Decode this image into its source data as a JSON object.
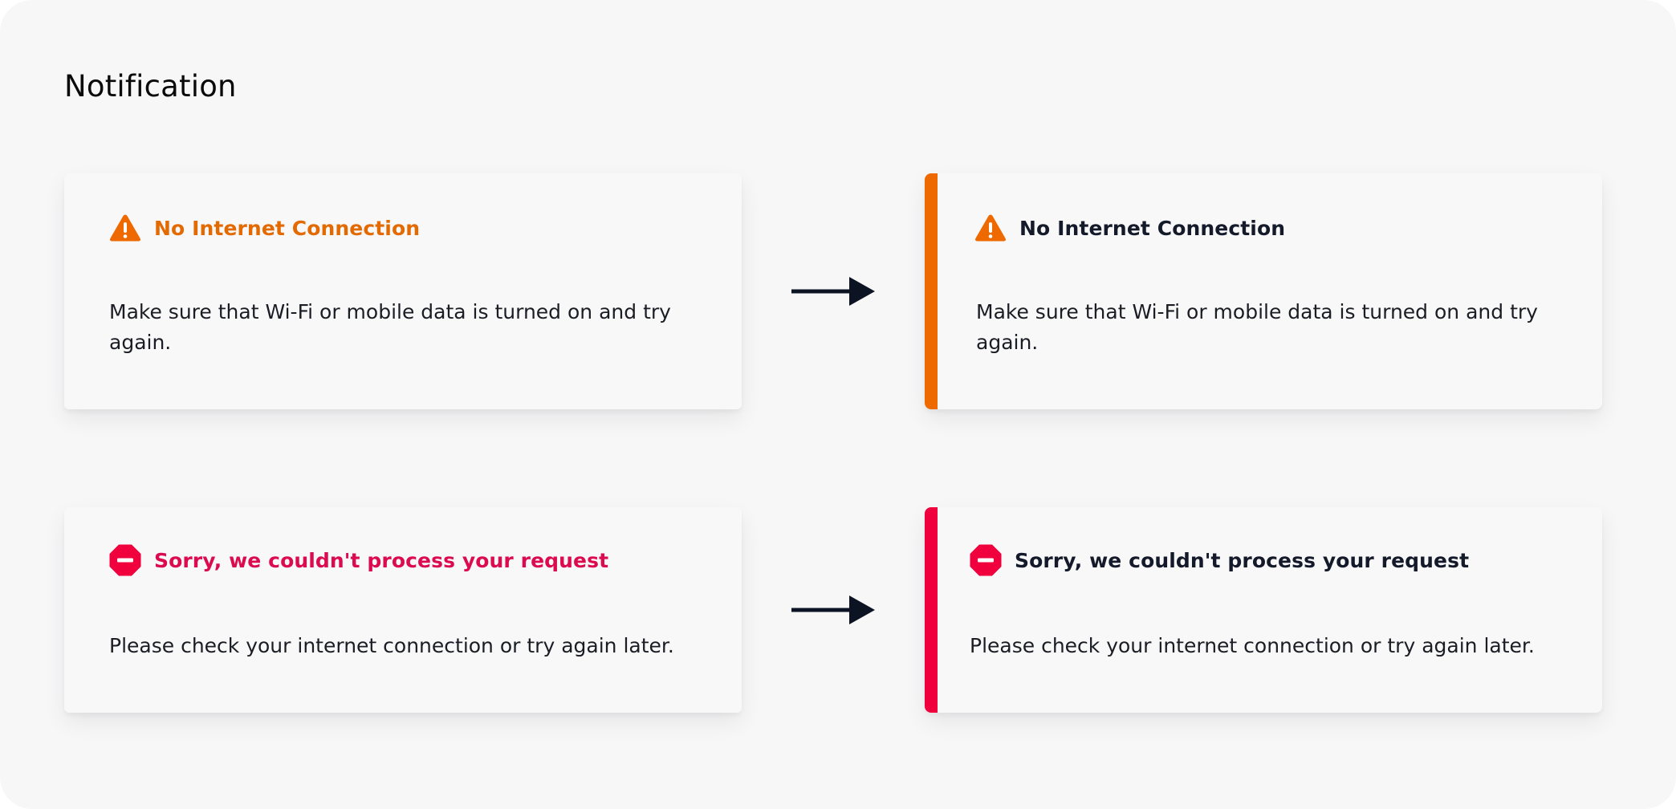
{
  "page": {
    "title": "Notification"
  },
  "colors": {
    "warning": "#ee6a00",
    "warning_text": "#e36a00",
    "error": "#f0003c",
    "error_text": "#dc0a4f",
    "dark_title": "#141a2a",
    "arrow": "#0c1424",
    "background": "#f7f7f8"
  },
  "notifications": [
    {
      "variant": "before",
      "kind": "warning",
      "icon": "warning-triangle-icon",
      "title": "No Internet Connection",
      "message": "Make sure that Wi-Fi or mobile data is turned on and try again."
    },
    {
      "variant": "after",
      "kind": "warning",
      "icon": "warning-triangle-icon",
      "title": "No Internet Connection",
      "message": "Make sure that Wi-Fi or mobile data is turned on and try again."
    },
    {
      "variant": "before",
      "kind": "error",
      "icon": "stop-octagon-icon",
      "title": "Sorry, we couldn't process your request",
      "message": "Please check your internet connection or try again later."
    },
    {
      "variant": "after",
      "kind": "error",
      "icon": "stop-octagon-icon",
      "title": "Sorry, we couldn't process your request",
      "message": "Please check your internet connection or try again later."
    }
  ],
  "arrows": [
    {
      "icon": "right-arrow-icon"
    },
    {
      "icon": "right-arrow-icon"
    }
  ]
}
